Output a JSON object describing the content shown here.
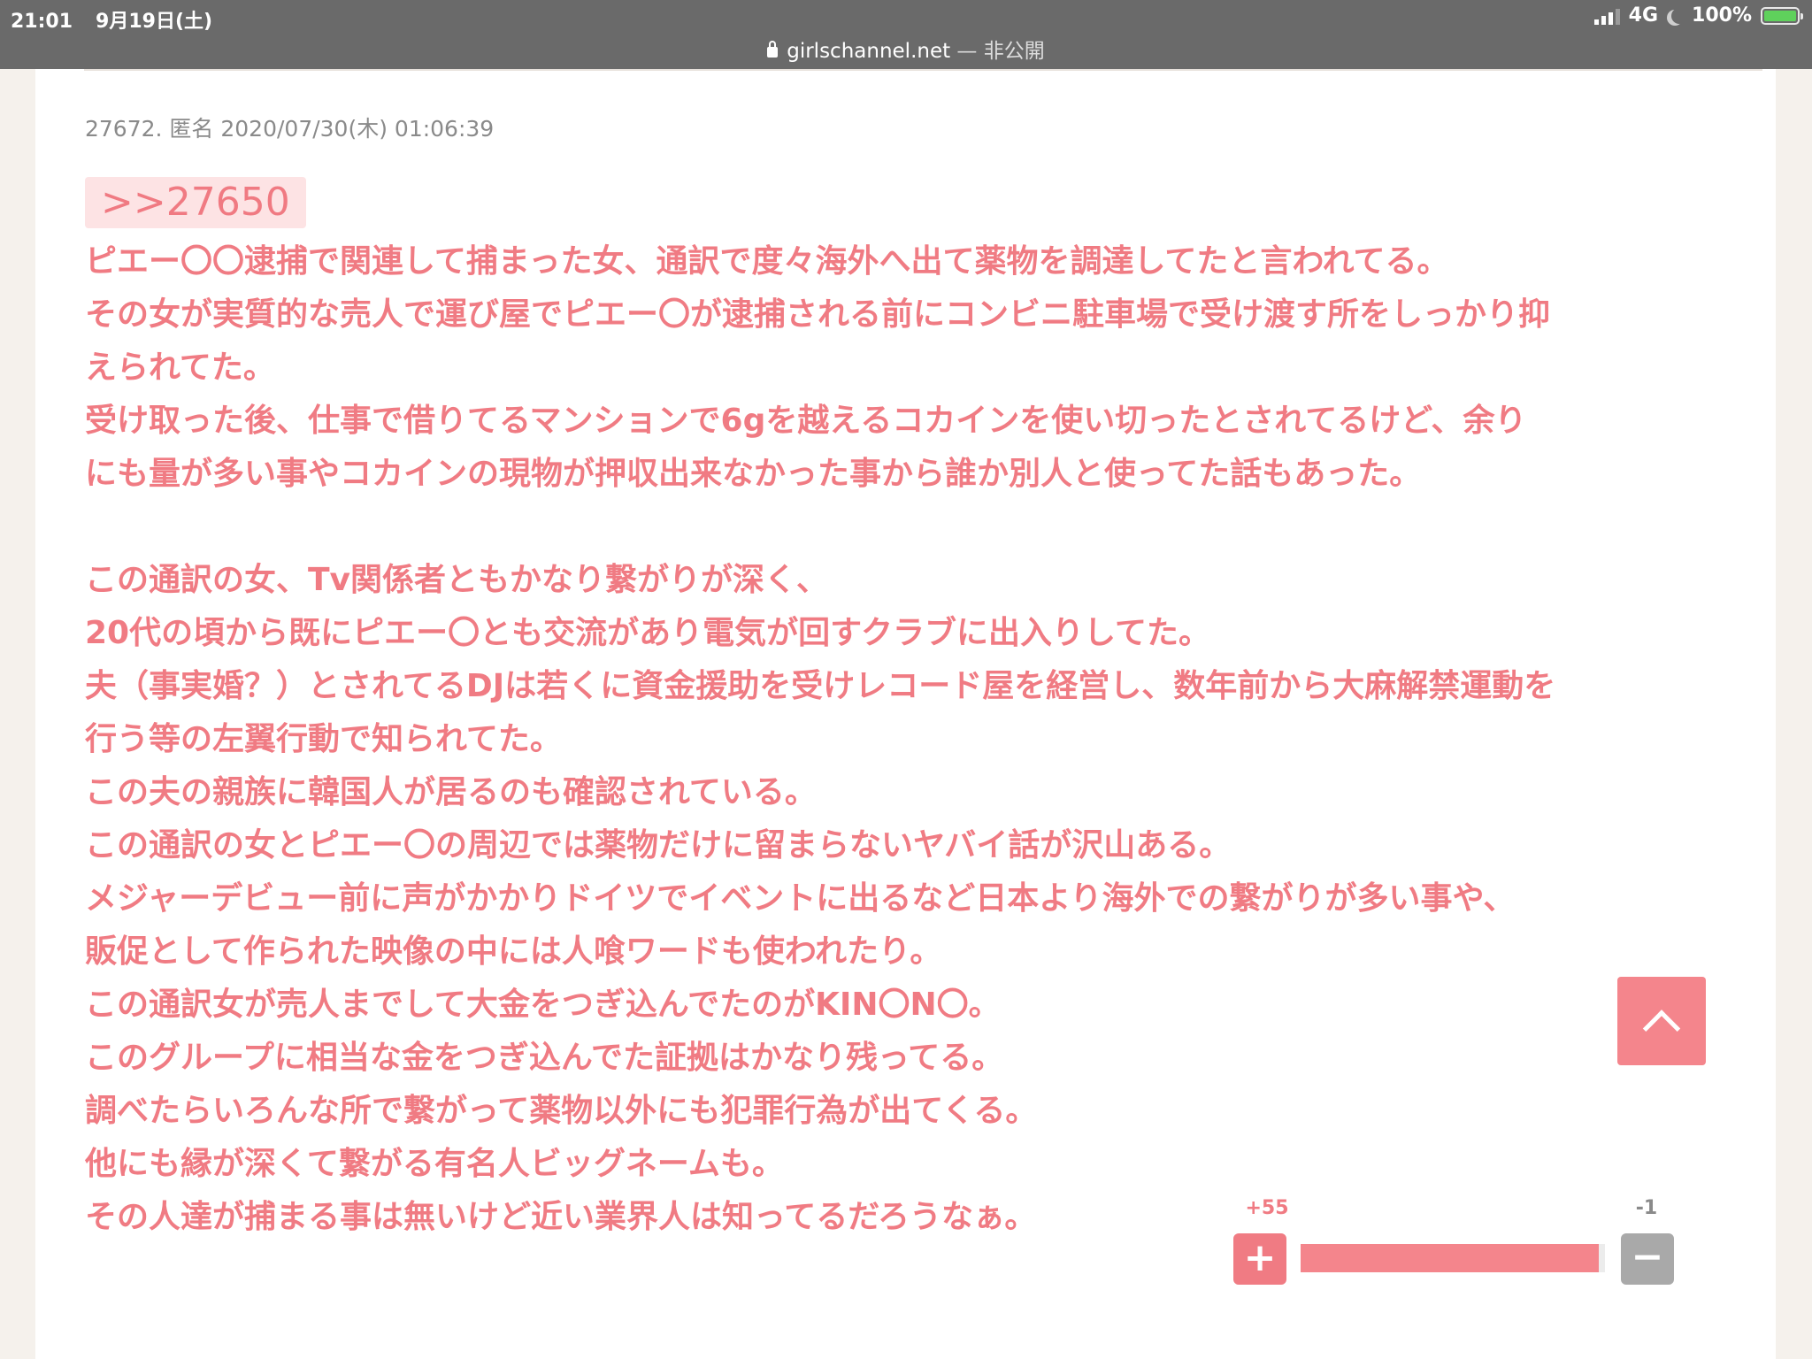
{
  "status_bar": {
    "time": "21:01",
    "date": "9月19日(土)",
    "network": "4G",
    "battery": "100%",
    "battery_level": 1.0
  },
  "url_bar": {
    "domain": "girlschannel.net",
    "suffix": " — 非公開"
  },
  "comment": {
    "meta": "27672. 匿名 2020/07/30(木) 01:06:39",
    "reply_anchor": ">>27650",
    "lines": [
      "ピエー〇〇逮捕で関連して捕まった女、通訳で度々海外へ出て薬物を調達してたと言われてる。",
      "その女が実質的な売人で運び屋でピエー〇が逮捕される前にコンビニ駐車場で受け渡す所をしっかり抑",
      "えられてた。",
      "受け取った後、仕事で借りてるマンションで6gを越えるコカインを使い切ったとされてるけど、余り",
      "にも量が多い事やコカインの現物が押収出来なかった事から誰か別人と使ってた話もあった。",
      "",
      "この通訳の女、Tv関係者ともかなり繋がりが深く、",
      "20代の頃から既にピエー〇とも交流があり電気が回すクラブに出入りしてた。",
      "夫（事実婚？）とされてるDJは若くに資金援助を受けレコード屋を経営し、数年前から大麻解禁運動を",
      "行う等の左翼行動で知られてた。",
      "この夫の親族に韓国人が居るのも確認されている。",
      "この通訳の女とピエー〇の周辺では薬物だけに留まらないヤバイ話が沢山ある。",
      "メジャーデビュー前に声がかかりドイツでイベントに出るなど日本より海外での繋がりが多い事や、",
      "販促として作られた映像の中には人喰ワードも使われたり。",
      "この通訳女が売人までして大金をつぎ込んでたのがKIN〇N〇。",
      "このグループに相当な金をつぎ込んでた証拠はかなり残ってる。",
      "調べたらいろんな所で繋がって薬物以外にも犯罪行為が出てくる。",
      "他にも縁が深くて繋がる有名人ビッグネームも。",
      "その人達が捕まる事は無いけど近い業界人は知ってるだろうなぁ。"
    ]
  },
  "votes": {
    "plus_label": "+55",
    "minus_label": "-1",
    "plus_button": "+",
    "minus_button": "−",
    "plus_ratio": 0.98
  },
  "colors": {
    "accent": "#f07b83",
    "status_bar": "#6a6a6a"
  },
  "icons": [
    "lock-icon",
    "signal-icon",
    "moon-icon",
    "battery-icon",
    "chevron-up-icon"
  ]
}
